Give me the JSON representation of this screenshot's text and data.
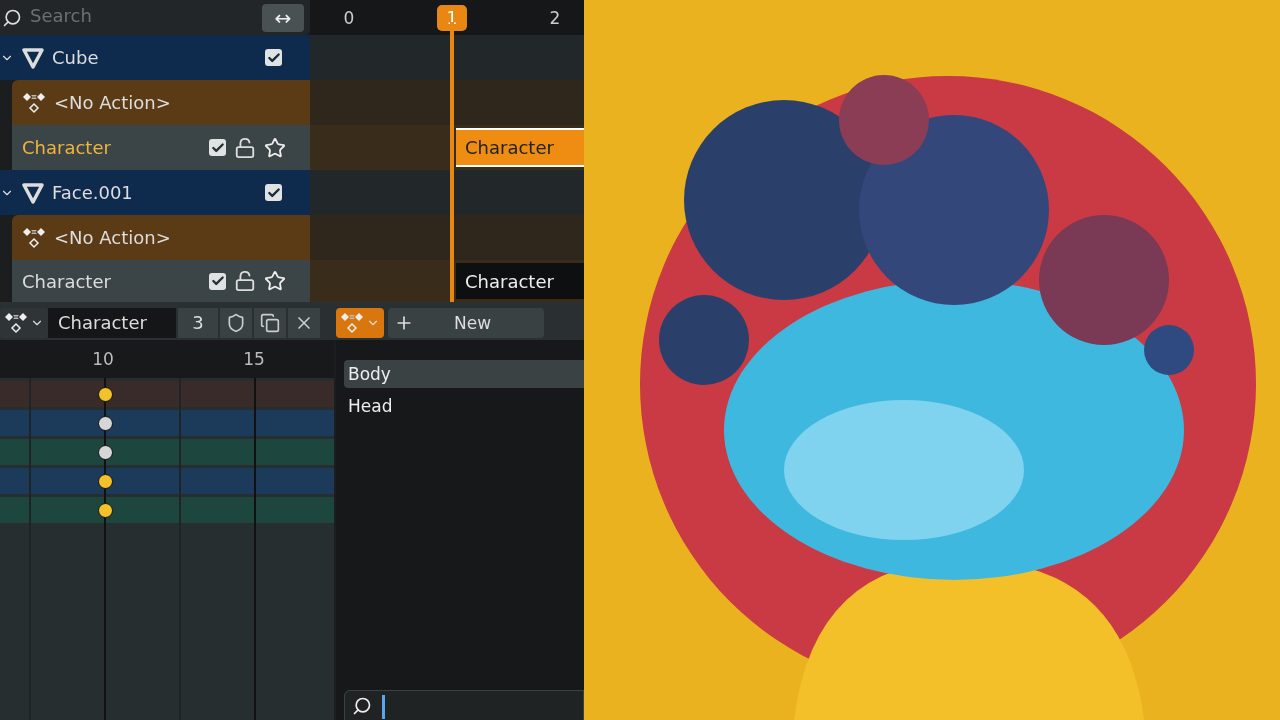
{
  "outliner": {
    "search": {
      "placeholder": "Search"
    },
    "swap_button": "↔"
  },
  "ruler": [
    {
      "label": "0",
      "current": false
    },
    {
      "label": "1",
      "current": true
    },
    {
      "label": "2",
      "current": false
    }
  ],
  "tracks": [
    {
      "kind": "object",
      "name": "Cube",
      "expanded": true,
      "checked": true
    },
    {
      "kind": "action",
      "name": "<No Action>"
    },
    {
      "kind": "nla",
      "name": "Character",
      "selected": true,
      "checked": true,
      "locked": false,
      "solo": false,
      "strip": {
        "label": "Character",
        "selected": true
      }
    },
    {
      "kind": "object",
      "name": "Face.001",
      "expanded": true,
      "checked": true
    },
    {
      "kind": "action",
      "name": "<No Action>"
    },
    {
      "kind": "nla",
      "name": "Character",
      "selected": false,
      "checked": true,
      "locked": false,
      "solo": false,
      "strip": {
        "label": "Character",
        "selected": false
      }
    }
  ],
  "action_bar": {
    "action_name": "Character",
    "users": "3",
    "new_button": "New"
  },
  "dopesheet": {
    "ticks": [
      "10",
      "15"
    ],
    "channels": [
      {
        "color": "#3a2b2b",
        "keyframe_selected": true
      },
      {
        "color": "#1c3a5a",
        "keyframe_selected": false
      },
      {
        "color": "#1d463f",
        "keyframe_selected": false
      },
      {
        "color": "#1c3a5a",
        "keyframe_selected": true
      },
      {
        "color": "#1d463f",
        "keyframe_selected": true
      }
    ]
  },
  "slot_list": {
    "items": [
      {
        "label": "Body",
        "selected": true
      },
      {
        "label": "Head",
        "selected": false
      }
    ]
  }
}
